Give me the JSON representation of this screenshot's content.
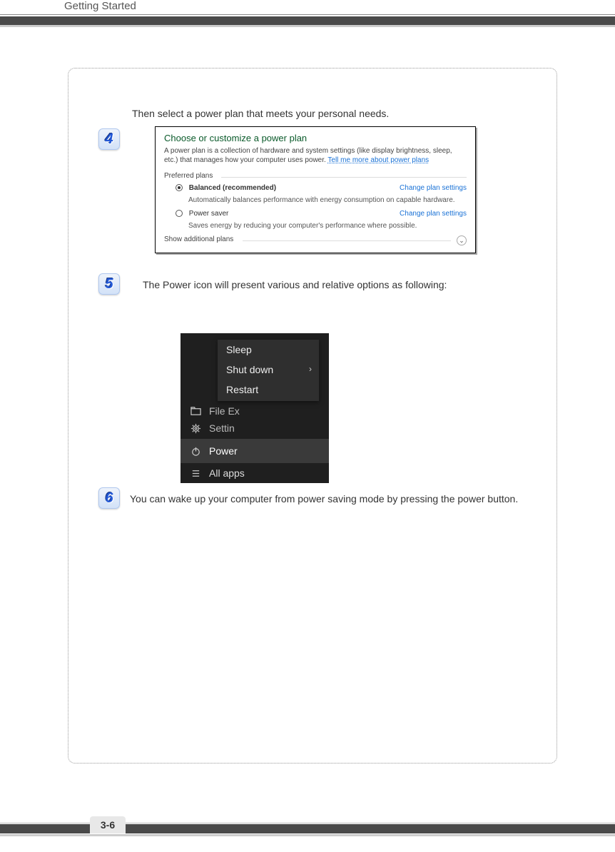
{
  "header": {
    "title": "Getting Started"
  },
  "footer": {
    "page_number": "3-6"
  },
  "steps": {
    "s4": {
      "badge": "4",
      "text": "Then select a power plan that meets your personal needs."
    },
    "s5": {
      "badge": "5",
      "text": "The Power icon will present various and relative options as following:"
    },
    "s6": {
      "badge": "6",
      "text": "You can wake up your computer from power saving mode by pressing the power button."
    }
  },
  "power_panel": {
    "title": "Choose or customize a power plan",
    "description": "A power plan is a collection of hardware and system settings (like display brightness, sleep, etc.) that manages how your computer uses power. ",
    "more_link": "Tell me more about power plans",
    "preferred_label": "Preferred plans",
    "plans": [
      {
        "name": "Balanced (recommended)",
        "desc": "Automatically balances performance with energy consumption on capable hardware.",
        "selected": true,
        "change": "Change plan settings"
      },
      {
        "name": "Power saver",
        "desc": "Saves energy by reducing your computer's performance where possible.",
        "selected": false,
        "change": "Change plan settings"
      }
    ],
    "show_additional": "Show additional plans"
  },
  "power_menu": {
    "flyout": {
      "sleep": "Sleep",
      "shutdown": "Shut down",
      "restart": "Restart"
    },
    "rows": {
      "file_explorer": "File Ex",
      "settings": "Settin",
      "power": "Power",
      "all_apps": "All apps"
    }
  }
}
